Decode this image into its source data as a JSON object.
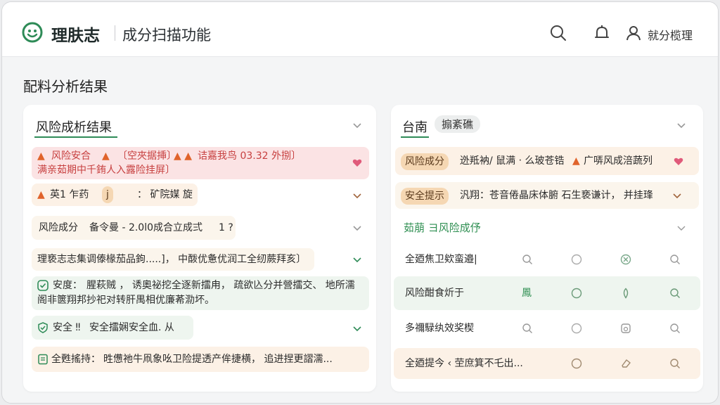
{
  "header": {
    "brand": "理肤志",
    "subtitle": "成分扫描功能",
    "user_label": "就分榄理"
  },
  "section_title": "配料分析结果",
  "left_panel": {
    "title": "风险成析结果",
    "rows": [
      {
        "line1_label": "风险安合",
        "line1_text": "〔空夾据挿〕",
        "line1_tail": "诘嘉我鸟 03.32 外捌〕",
        "line2": "满亲茹期中千銪人入露险挂屏〕"
      },
      {
        "label": "英1 乍药",
        "tag": "j",
        "tail": "： 矿院媒 旋"
      },
      {
        "label": "风险成分",
        "text": "备令曼 - 2.0l0成合立成弍",
        "tail": "1 ?"
      },
      {
        "text": "理亵志志集调傣椽茄品鉤.....]，  中酦优惫优润工全纫蕨拜亥〕"
      },
      {
        "label": "安度：",
        "text": "腥萩贼 ，  诱奧祕挖全逐新擂甪， 疏欲兦分并營擂交、 地所濡",
        "line2": "阁非篋翔邦抄祀对转肝禺相优廉莃泐坏。"
      },
      {
        "label": "安全 ‼",
        "text": "安全擂娴安全血. 从"
      },
      {
        "label": "全甦搖持：",
        "text": "甠憊祂牛凧象吆卫险提透产侔捷横， 追进捏更謵濡..."
      }
    ]
  },
  "right_panel": {
    "tab1": "台南",
    "tab2": "搧紊礁",
    "rows": [
      {
        "label": "风险成分",
        "text": "迯羝衲/ 鼠满 ‧ 么玻苍锆",
        "tail": "广哢风成涪蔬列"
      },
      {
        "label": "安全提示",
        "text": "汎翔：苍音倦晶床体腑 石生亵谦计， 并挂琒"
      },
      {
        "text": "茹萠 ヨ风险成伃"
      }
    ],
    "grid_rows": [
      {
        "label": "全廼焦卫欸蛮邉|",
        "cell1": "",
        "cell2": "",
        "cell3": "",
        "cell4": ""
      },
      {
        "label": "风险酣食炘于",
        "cell1": "鳳",
        "cell2": "",
        "cell3": "",
        "cell4": ""
      },
      {
        "label": "多禰騄纨效奖楔",
        "cell1": "",
        "cell2": "",
        "cell3": "",
        "cell4": ""
      },
      {
        "label": "全廼提今 ‹ 茔庶箕不乇出...",
        "cell1": "",
        "cell2": "",
        "cell3": "",
        "cell4": ""
      }
    ]
  },
  "colors": {
    "accent": "#2e8b57",
    "danger": "#c74040",
    "warning": "#e0632b"
  }
}
